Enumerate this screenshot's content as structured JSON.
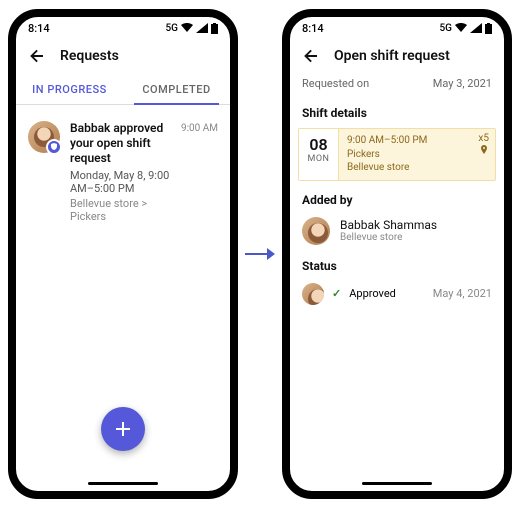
{
  "status": {
    "time": "8:14",
    "net": "5G"
  },
  "left": {
    "title": "Requests",
    "tabs": {
      "inprogress": "IN PROGRESS",
      "completed": "COMPLETED"
    },
    "item": {
      "title": "Babbak approved your open shift request",
      "sub": "Monday, May 8, 9:00 AM–5:00 PM",
      "crumb": "Bellevue store > Pickers",
      "time": "9:00 AM"
    }
  },
  "right": {
    "title": "Open shift request",
    "requested_label": "Requested on",
    "requested_date": "May 3, 2021",
    "shift_head": "Shift details",
    "shift": {
      "day_num": "08",
      "day_dow": "MON",
      "time": "9:00 AM–5:00 PM",
      "group": "Pickers",
      "store": "Bellevue store",
      "count": "x5"
    },
    "added_head": "Added by",
    "added": {
      "name": "Babbak Shammas",
      "sub": "Bellevue store"
    },
    "status_head": "Status",
    "status": {
      "text": "Approved",
      "date": "May 4, 2021"
    }
  }
}
